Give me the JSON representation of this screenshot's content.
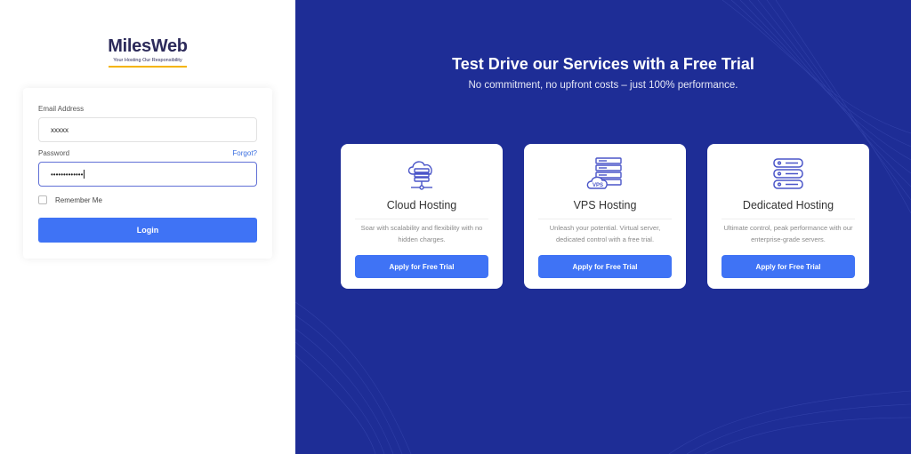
{
  "brand": {
    "name": "MilesWeb",
    "tagline": "Your Hosting Our Responsibility",
    "accent": "#f4b400"
  },
  "login": {
    "email_label": "Email Address",
    "email_value": "xxxxx",
    "password_label": "Password",
    "password_value": "•••••••••••••",
    "forgot_label": "Forgot?",
    "remember_label": "Remember Me",
    "remember_checked": false,
    "login_button": "Login"
  },
  "promo": {
    "headline": "Test Drive our Services with a Free Trial",
    "subline": "No commitment, no upfront costs – just 100% performance.",
    "background": "#1e2d96",
    "cards": [
      {
        "icon": "cloud-server-icon",
        "title": "Cloud Hosting",
        "description": "Soar with scalability and flexibility with no hidden charges.",
        "button": "Apply for Free Trial"
      },
      {
        "icon": "vps-server-icon",
        "title": "VPS Hosting",
        "description": "Unleash your potential. Virtual server, dedicated control with a free trial.",
        "button": "Apply for Free Trial"
      },
      {
        "icon": "dedicated-server-icon",
        "title": "Dedicated Hosting",
        "description": "Ultimate control, peak performance with our enterprise-grade servers.",
        "button": "Apply for Free Trial"
      }
    ]
  },
  "colors": {
    "primary_button": "#3f73f5",
    "icon_stroke": "#4a55c8"
  }
}
